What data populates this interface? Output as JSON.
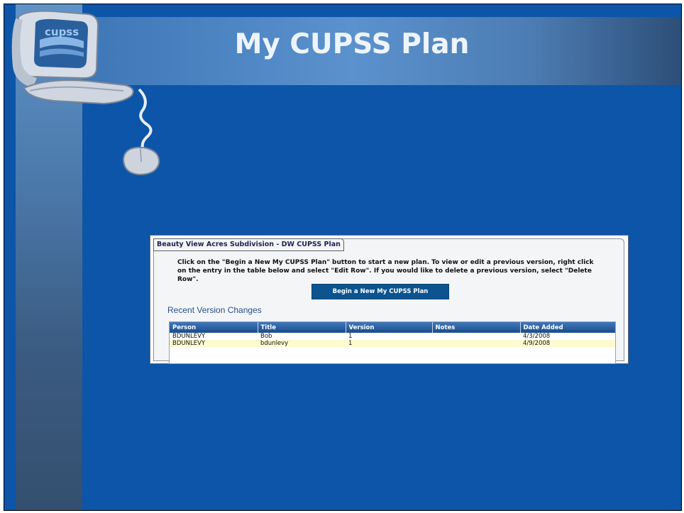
{
  "slide": {
    "title": "My CUPSS Plan"
  },
  "logo": {
    "text": "cupss"
  },
  "app": {
    "tab_label": "Beauty View Acres Subdivision - DW CUPSS Plan",
    "instructions": "Click on the \"Begin a New My CUPSS Plan\" button to start a new plan.  To view or edit a previous version, right click on the entry in the table below and select \"Edit Row\".  If you would like to delete a previous version, select \"Delete Row\".",
    "begin_button": "Begin a New My CUPSS Plan",
    "section_title": "Recent Version Changes",
    "columns": [
      "Person",
      "Title",
      "Version",
      "Notes",
      "Date Added"
    ],
    "rows": [
      [
        "BDUNLEVY",
        "Bob",
        "1",
        "",
        "4/3/2008"
      ],
      [
        "BDUNLEVY",
        "bdunlevy",
        "1",
        "",
        "4/9/2008"
      ]
    ]
  }
}
